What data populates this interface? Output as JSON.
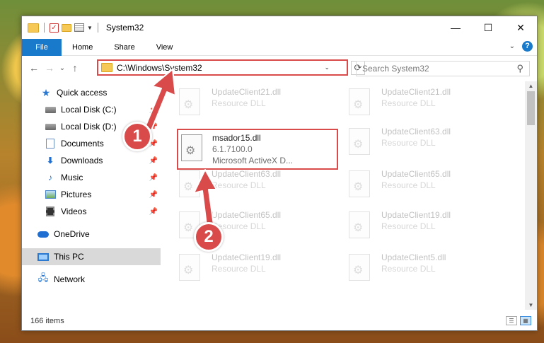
{
  "titlebar": {
    "title": "System32",
    "minimize": "—",
    "maximize": "☐",
    "close": "✕"
  },
  "ribbon": {
    "tabs": [
      "File",
      "Home",
      "Share",
      "View"
    ],
    "collapse": "⌄",
    "help": "?"
  },
  "nav": {
    "back": "←",
    "forward": "→",
    "recent": "⌄",
    "up": "↑"
  },
  "address": {
    "path": "C:\\Windows\\System32",
    "dropdown": "⌄",
    "refresh": "⟳"
  },
  "search": {
    "placeholder": "Search System32",
    "icon": "search-icon"
  },
  "sidebar": {
    "items": [
      {
        "label": "Quick access",
        "icon": "star-icon"
      },
      {
        "label": "Local Disk (C:)",
        "icon": "disk-icon"
      },
      {
        "label": "Local Disk (D:)",
        "icon": "disk-icon"
      },
      {
        "label": "Documents",
        "icon": "documents-icon"
      },
      {
        "label": "Downloads",
        "icon": "downloads-icon"
      },
      {
        "label": "Music",
        "icon": "music-icon"
      },
      {
        "label": "Pictures",
        "icon": "pictures-icon"
      },
      {
        "label": "Videos",
        "icon": "videos-icon"
      },
      {
        "label": "OneDrive",
        "icon": "onedrive-icon"
      },
      {
        "label": "This PC",
        "icon": "pc-icon",
        "selected": true
      },
      {
        "label": "Network",
        "icon": "network-icon"
      }
    ]
  },
  "files": {
    "highlighted": {
      "name": "msador15.dll",
      "version": "6.1.7100.0",
      "description": "Microsoft ActiveX D..."
    },
    "left_column": [
      {
        "name": "UpdateClient21.dll",
        "type": "Resource DLL"
      },
      {
        "name": "UpdateClient63.dll",
        "type": "Resource DLL"
      },
      {
        "name": "UpdateClient65.dll",
        "type": "Resource DLL"
      },
      {
        "name": "UpdateClient19.dll",
        "type": "Resource DLL"
      }
    ],
    "right_column": [
      {
        "name": "UpdateClient21.dll",
        "type": "Resource DLL"
      },
      {
        "name": "UpdateClient63.dll",
        "type": "Resource DLL"
      },
      {
        "name": "UpdateClient65.dll",
        "type": "Resource DLL"
      },
      {
        "name": "UpdateClient19.dll",
        "type": "Resource DLL"
      },
      {
        "name": "UpdateClient5.dll",
        "type": "Resource DLL"
      }
    ]
  },
  "status": {
    "item_count": "166 items"
  },
  "annotations": {
    "step1": "1",
    "step2": "2",
    "color": "#d94a4a"
  }
}
